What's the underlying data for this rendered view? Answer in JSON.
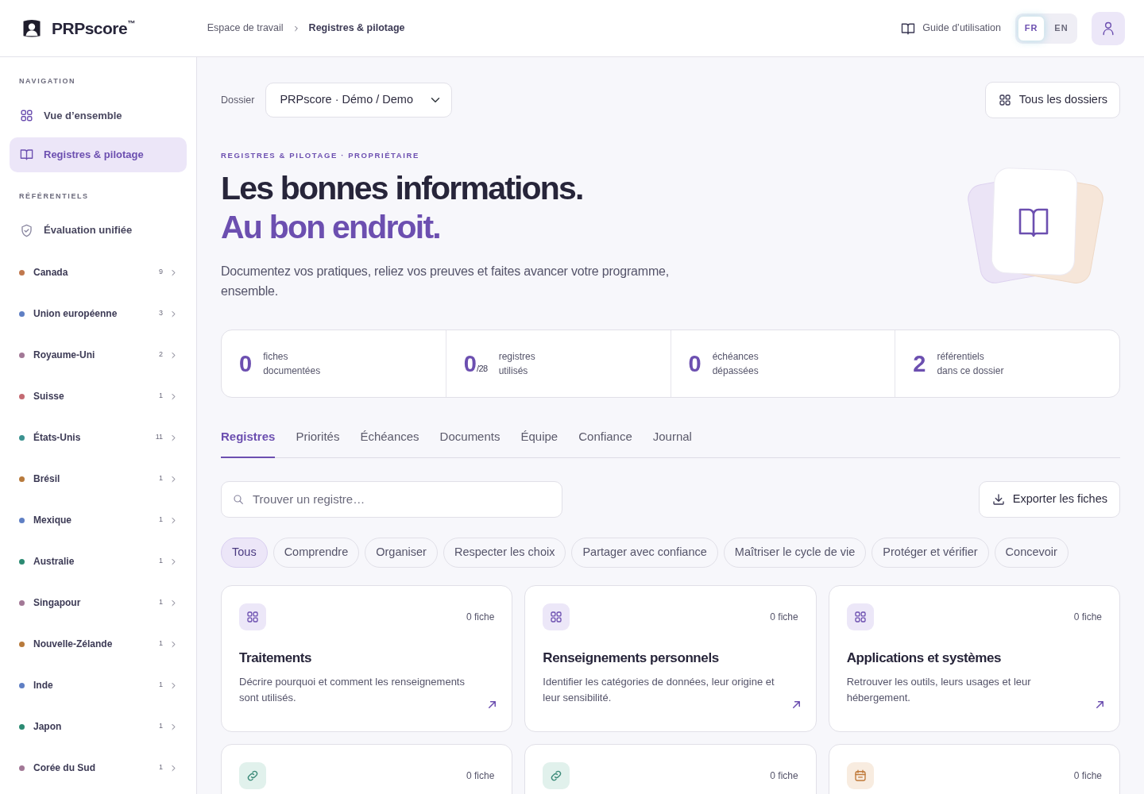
{
  "header": {
    "brand": "PRPscore",
    "trademark": "™",
    "breadcrumb": [
      {
        "label": "Espace de travail",
        "current": false
      },
      {
        "label": "Registres & pilotage",
        "current": true
      }
    ],
    "guide": "Guide d’utilisation",
    "languages": [
      {
        "label": "FR",
        "selected": true
      },
      {
        "label": "EN",
        "selected": false
      }
    ]
  },
  "sidebar": {
    "sections": [
      {
        "title": "NAVIGATION",
        "items": [
          {
            "label": "Vue d’ensemble",
            "kind": "grid",
            "selected": false
          },
          {
            "label": "Registres & pilotage",
            "kind": "book",
            "selected": true
          }
        ]
      },
      {
        "title": "RÉFÉRENTIELS",
        "items": [
          {
            "label": "Évaluation unifiée",
            "kind": "shield",
            "selected": false
          }
        ]
      }
    ],
    "jurisdictions": [
      {
        "label": "Canada",
        "count": "9",
        "color": "#c0784e"
      },
      {
        "label": "Union européenne",
        "count": "3",
        "color": "#5f7fc4"
      },
      {
        "label": "Royaume-Uni",
        "count": "2",
        "color": "#a27896"
      },
      {
        "label": "Suisse",
        "count": "1",
        "color": "#c46a72"
      },
      {
        "label": "États-Unis",
        "count": "11",
        "color": "#3b9290"
      },
      {
        "label": "Brésil",
        "count": "1",
        "color": "#b87a3c"
      },
      {
        "label": "Mexique",
        "count": "1",
        "color": "#5f7fc4"
      },
      {
        "label": "Australie",
        "count": "1",
        "color": "#2b8a72"
      },
      {
        "label": "Singapour",
        "count": "1",
        "color": "#a27896"
      },
      {
        "label": "Nouvelle-Zélande",
        "count": "1",
        "color": "#b87a3c"
      },
      {
        "label": "Inde",
        "count": "1",
        "color": "#5f7fc4"
      },
      {
        "label": "Japon",
        "count": "1",
        "color": "#2b8a72"
      },
      {
        "label": "Corée du Sud",
        "count": "1",
        "color": "#a27896"
      }
    ]
  },
  "folder": {
    "label": "Dossier",
    "value": "PRPscore · Démo / Demo",
    "all_button": "Tous les dossiers"
  },
  "hero": {
    "eyebrow": "REGISTRES & PILOTAGE · PROPRIÉTAIRE",
    "title": "Les bonnes informations.",
    "title_accent": "Au bon endroit.",
    "lead": "Documentez vos pratiques, reliez vos preuves et faites avancer votre programme, ensemble."
  },
  "stats": [
    {
      "value": "0",
      "lines": [
        "fiches",
        "documentées"
      ]
    },
    {
      "value": "0",
      "suffix": "/28",
      "lines": [
        "registres",
        "utilisés"
      ]
    },
    {
      "value": "0",
      "lines": [
        "échéances",
        "dépassées"
      ]
    },
    {
      "value": "2",
      "lines": [
        "référentiels",
        "dans ce dossier"
      ]
    }
  ],
  "tabs": [
    {
      "label": "Registres",
      "selected": true
    },
    {
      "label": "Priorités",
      "selected": false
    },
    {
      "label": "Échéances",
      "selected": false
    },
    {
      "label": "Documents",
      "selected": false
    },
    {
      "label": "Équipe",
      "selected": false
    },
    {
      "label": "Confiance",
      "selected": false
    },
    {
      "label": "Journal",
      "selected": false
    }
  ],
  "search": {
    "placeholder": "Trouver un registre…"
  },
  "export_button": "Exporter les fiches",
  "filters": [
    {
      "label": "Tous",
      "selected": true
    },
    {
      "label": "Comprendre",
      "selected": false
    },
    {
      "label": "Organiser",
      "selected": false
    },
    {
      "label": "Respecter les choix",
      "selected": false
    },
    {
      "label": "Partager avec confiance",
      "selected": false
    },
    {
      "label": "Maîtriser le cycle de vie",
      "selected": false
    },
    {
      "label": "Protéger et vérifier",
      "selected": false
    },
    {
      "label": "Concevoir",
      "selected": false
    }
  ],
  "registers": [
    {
      "kind": "grid",
      "count": "0 fiche",
      "title": "Traitements",
      "description": "Décrire pourquoi et comment les renseignements sont utilisés."
    },
    {
      "kind": "grid",
      "count": "0 fiche",
      "title": "Renseignements personnels",
      "description": "Identifier les catégories de données, leur origine et leur sensibilité."
    },
    {
      "kind": "grid",
      "count": "0 fiche",
      "title": "Applications et systèmes",
      "description": "Retrouver les outils, leurs usages et leur hébergement."
    },
    {
      "kind": "link",
      "count": "0 fiche"
    },
    {
      "kind": "link",
      "count": "0 fiche"
    },
    {
      "kind": "calendar",
      "count": "0 fiche"
    }
  ]
}
